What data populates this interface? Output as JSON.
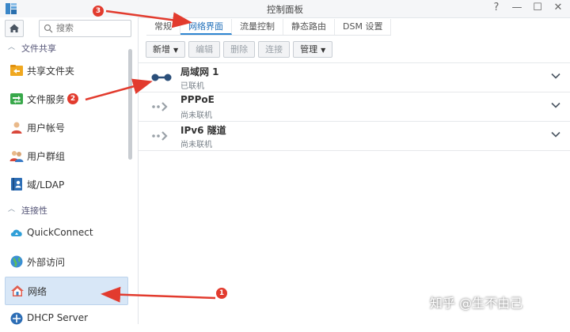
{
  "window": {
    "title": "控制面板",
    "controls": [
      "?",
      "—",
      "☐",
      "✕"
    ]
  },
  "sidebar": {
    "search_placeholder": "搜索",
    "groups": [
      {
        "label": "文件共享"
      },
      {
        "label": "连接性"
      }
    ],
    "items": [
      {
        "label": "共享文件夹",
        "icon": "shared-folder-icon"
      },
      {
        "label": "文件服务",
        "icon": "file-services-icon"
      },
      {
        "label": "用户帐号",
        "icon": "user-icon"
      },
      {
        "label": "用户群组",
        "icon": "group-icon"
      },
      {
        "label": "域/LDAP",
        "icon": "directory-icon"
      },
      {
        "label": "QuickConnect",
        "icon": "quickconnect-icon"
      },
      {
        "label": "外部访问",
        "icon": "globe-icon"
      },
      {
        "label": "网络",
        "icon": "network-home-icon",
        "active": true
      },
      {
        "label": "DHCP Server",
        "icon": "dhcp-icon"
      }
    ]
  },
  "tabs": [
    {
      "label": "常规"
    },
    {
      "label": "网络界面",
      "active": true
    },
    {
      "label": "流量控制"
    },
    {
      "label": "静态路由"
    },
    {
      "label": "DSM 设置"
    }
  ],
  "toolbar": {
    "new": "新增",
    "edit": "编辑",
    "delete": "删除",
    "connect": "连接",
    "manage": "管理"
  },
  "interfaces": [
    {
      "name": "局域网 1",
      "status": "已联机",
      "connected": true
    },
    {
      "name": "PPPoE",
      "status": "尚未联机",
      "connected": false
    },
    {
      "name": "IPv6 隧道",
      "status": "尚未联机",
      "connected": false
    }
  ],
  "annotations": [
    {
      "number": "1"
    },
    {
      "number": "2"
    },
    {
      "number": "3"
    }
  ],
  "watermark": "知乎 @生不由己",
  "colors": {
    "accent": "#2f86d1",
    "active_bg": "#d8e7f7",
    "annotation": "#e23b2e"
  }
}
